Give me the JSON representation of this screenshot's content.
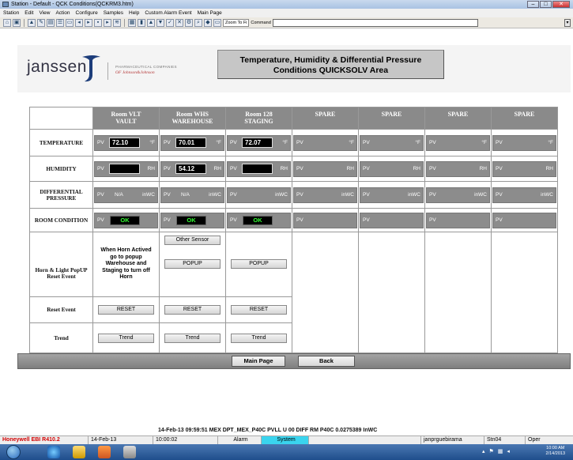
{
  "window": {
    "title": "Station - Default - QCK Conditions(QCKRM3.htm)"
  },
  "menu": [
    "Station",
    "Edit",
    "View",
    "Action",
    "Configure",
    "Samples",
    "Help",
    "Custom Alarm Event",
    "Main Page"
  ],
  "toolbar": {
    "zoom_label": "Zoom To Fi",
    "command_label": "Command",
    "command_value": ""
  },
  "header": {
    "logo_text": "janssen",
    "logo_tagline1": "PHARMACEUTICAL COMPANIES",
    "logo_tagline2": "OF Johnson&Johnson",
    "title_line1": "Temperature, Humidity & Differential Pressure",
    "title_line2": "Conditions QUICKSOLV Area"
  },
  "row_labels": {
    "temperature": "TEMPERATURE",
    "humidity": "HUMIDITY",
    "diff_line1": "DIFFERENTIAL",
    "diff_line2": "PRESSURE",
    "room_condition": "ROOM CONDITION",
    "horn_line1": "Horn & Light PopUP",
    "horn_line2": "Reset Event",
    "reset_event": "Reset Event",
    "trend": "Trend"
  },
  "rooms": [
    {
      "name1": "Room VLT",
      "name2": "VAULT",
      "temp": "72.10",
      "temp_unit": "°F",
      "hum": "",
      "hum_unit": "RH",
      "dp": "N/A",
      "dp_unit": "inWC",
      "cond": "OK"
    },
    {
      "name1": "Room WHS",
      "name2": "WAREHOUSE",
      "temp": "70.01",
      "temp_unit": "°F",
      "hum": "54.12",
      "hum_unit": "RH",
      "dp": "N/A",
      "dp_unit": "inWC",
      "cond": "OK"
    },
    {
      "name1": "Room 128",
      "name2": "STAGING",
      "temp": "72.07",
      "temp_unit": "°F",
      "hum": "",
      "hum_unit": "RH",
      "dp": "",
      "dp_unit": "inWC",
      "cond": "OK"
    }
  ],
  "spares": [
    {
      "name": "SPARE",
      "temp_unit": "°F",
      "hum_unit": "RH",
      "dp_unit": "inWC"
    },
    {
      "name": "SPARE",
      "temp_unit": "°F",
      "hum_unit": "RH",
      "dp_unit": "inWC"
    },
    {
      "name": "SPARE",
      "temp_unit": "°F",
      "hum_unit": "RH",
      "dp_unit": "inWC"
    },
    {
      "name": "SPARE",
      "temp_unit": "°F",
      "hum_unit": "RH",
      "dp_unit": "inWC"
    }
  ],
  "pv_label": "PV",
  "horn_note": [
    "When Horn Actived",
    "go to popup",
    "Warehouse and",
    "Staging to turn off",
    "Horn"
  ],
  "buttons": {
    "other_sensor": "Other Sensor",
    "popup": "POPUP",
    "reset": "RESET",
    "trend": "Trend"
  },
  "nav": {
    "main_page": "Main Page",
    "back": "Back"
  },
  "alarm_line": "14-Feb-13  09:59:51  MEX  DPT_MEX_P40C   PVLL   U 00 DIFF RM P40C  0.0275389   InWC",
  "status": {
    "product": "Honeywell EBI R410.2",
    "date": "14-Feb-13",
    "time": "10:00:02",
    "alarm": "Alarm",
    "system": "System",
    "user": "janprguebirama",
    "station": "Stn04",
    "mode": "Oper"
  },
  "taskbar": {
    "clock_time": "10:00 AM",
    "clock_date": "2/14/2013"
  },
  "colors": {
    "ok_green": "#33ff33",
    "status_system": "#3ad4ee",
    "honeywell_red": "#d10000"
  }
}
